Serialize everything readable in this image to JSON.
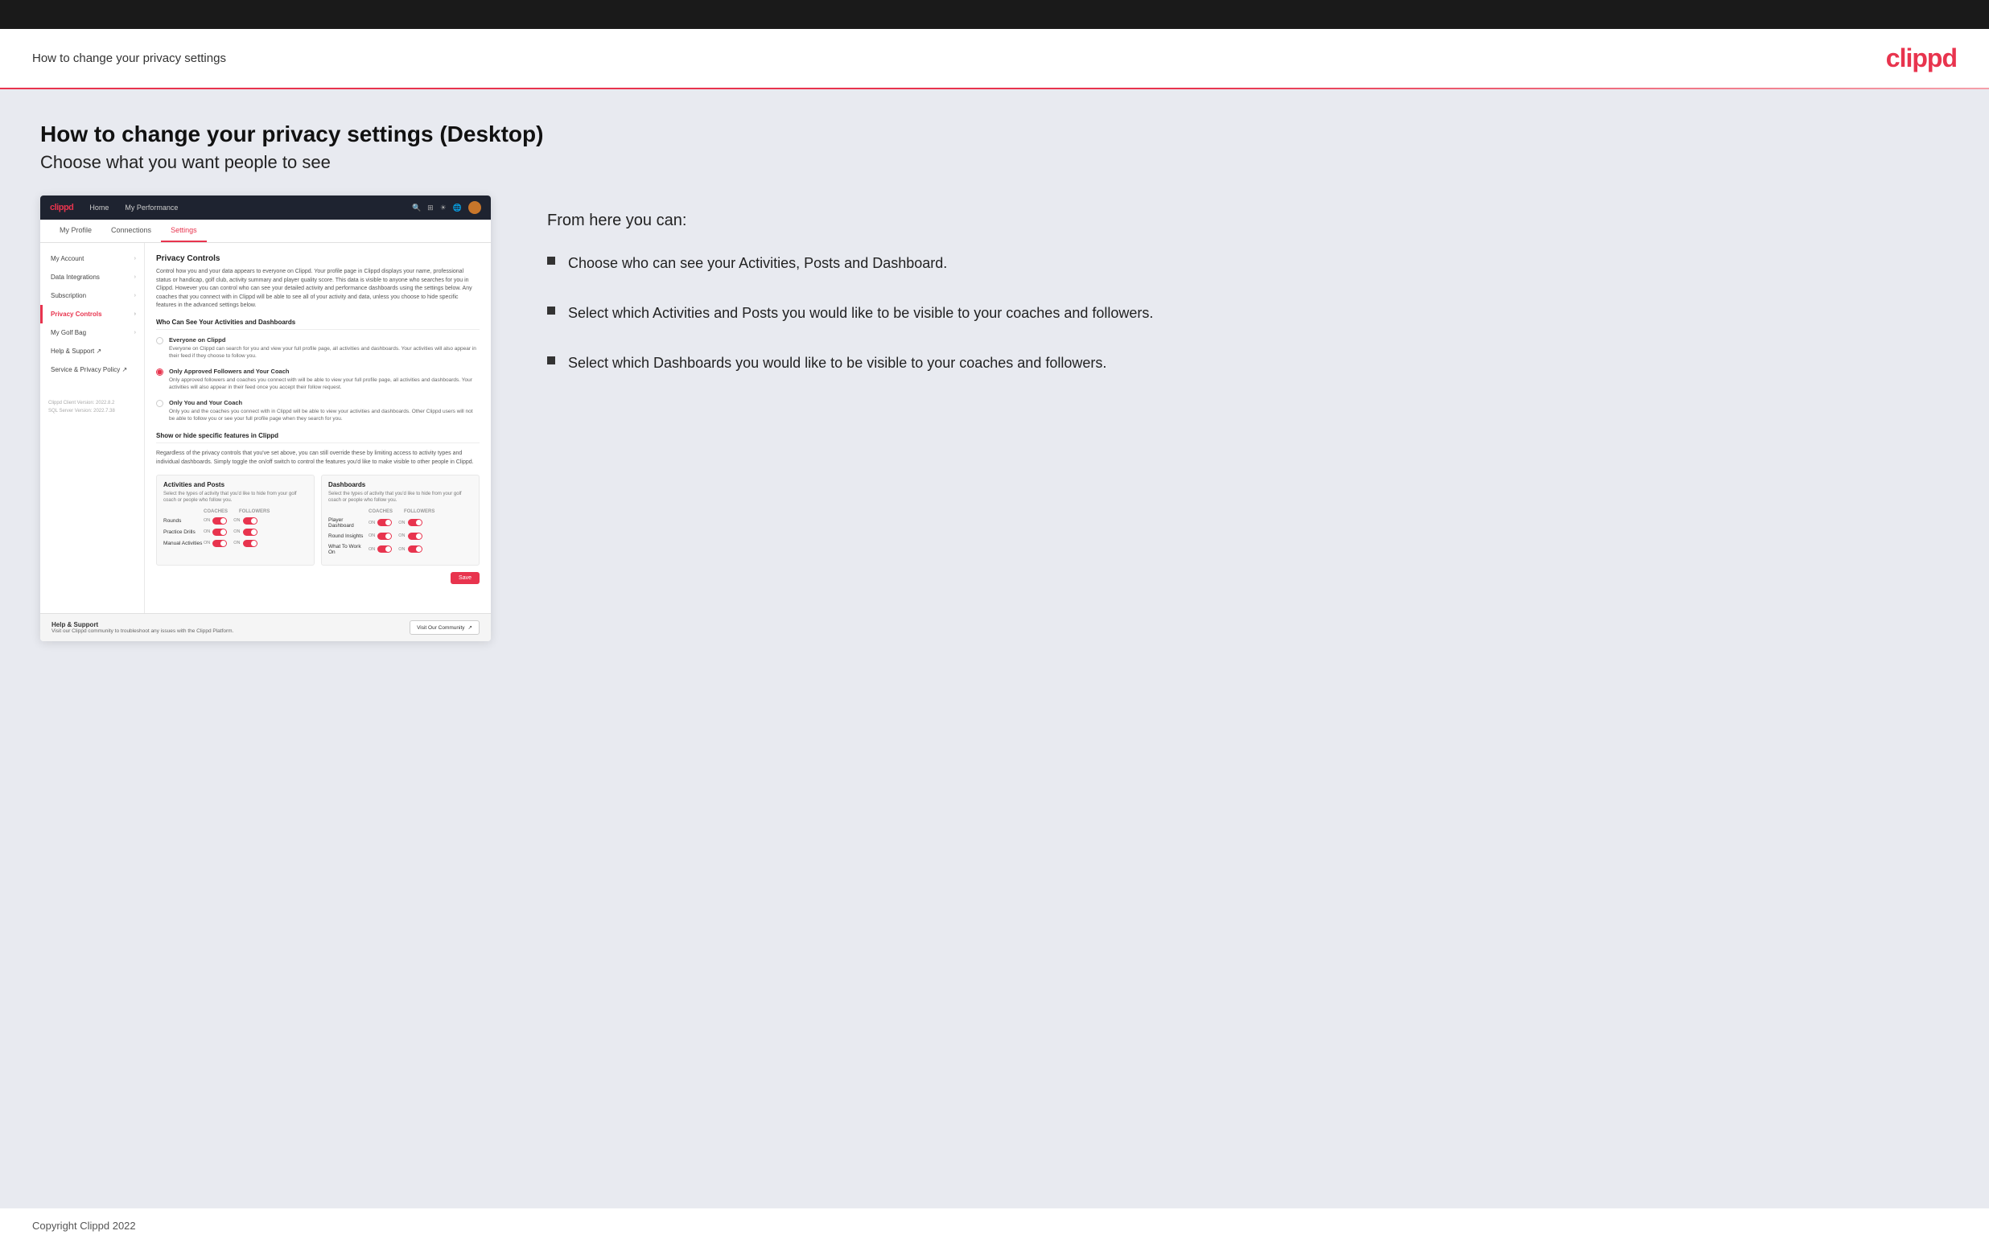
{
  "topBar": {},
  "header": {
    "title": "How to change your privacy settings",
    "logo": "clippd"
  },
  "page": {
    "heading": "How to change your privacy settings (Desktop)",
    "subheading": "Choose what you want people to see"
  },
  "rightPanel": {
    "title": "From here you can:",
    "bullets": [
      "Choose who can see your Activities, Posts and Dashboard.",
      "Select which Activities and Posts you would like to be visible to your coaches and followers.",
      "Select which Dashboards you would like to be visible to your coaches and followers."
    ]
  },
  "mockup": {
    "nav": {
      "logo": "clippd",
      "items": [
        "Home",
        "My Performance"
      ],
      "icons": [
        "🔍",
        "⊞",
        "☀",
        "🌐"
      ]
    },
    "subnav": {
      "items": [
        "My Profile",
        "Connections",
        "Settings"
      ]
    },
    "sidebar": {
      "items": [
        {
          "label": "My Account",
          "active": false
        },
        {
          "label": "Data Integrations",
          "active": false
        },
        {
          "label": "Subscription",
          "active": false
        },
        {
          "label": "Privacy Controls",
          "active": true
        },
        {
          "label": "My Golf Bag",
          "active": false
        },
        {
          "label": "Help & Support",
          "active": false
        },
        {
          "label": "Service & Privacy Policy",
          "active": false
        }
      ],
      "version": "Clippd Client Version: 2022.8.2\nSQL Server Version: 2022.7.38"
    },
    "main": {
      "sectionTitle": "Privacy Controls",
      "sectionDesc": "Control how you and your data appears to everyone on Clippd. Your profile page in Clippd displays your name, professional status or handicap, golf club, activity summary and player quality score. This data is visible to anyone who searches for you in Clippd. However you can control who can see your detailed activity and performance dashboards using the settings below. Any coaches that you connect with in Clippd will be able to see all of your activity and data, unless you choose to hide specific features in the advanced settings below.",
      "whoCanSee": {
        "title": "Who Can See Your Activities and Dashboards",
        "options": [
          {
            "label": "Everyone on Clippd",
            "desc": "Everyone on Clippd can search for you and view your full profile page, all activities and dashboards. Your activities will also appear in their feed if they choose to follow you.",
            "selected": false
          },
          {
            "label": "Only Approved Followers and Your Coach",
            "desc": "Only approved followers and coaches you connect with will be able to view your full profile page, all activities and dashboards. Your activities will also appear in their feed once you accept their follow request.",
            "selected": true
          },
          {
            "label": "Only You and Your Coach",
            "desc": "Only you and the coaches you connect with in Clippd will be able to view your activities and dashboards. Other Clippd users will not be able to follow you or see your full profile page when they search for you.",
            "selected": false
          }
        ]
      },
      "showHide": {
        "title": "Show or hide specific features in Clippd",
        "desc": "Regardless of the privacy controls that you've set above, you can still override these by limiting access to activity types and individual dashboards. Simply toggle the on/off switch to control the features you'd like to make visible to other people in Clippd.",
        "activities": {
          "title": "Activities and Posts",
          "desc": "Select the types of activity that you'd like to hide from your golf coach or people who follow you.",
          "headers": [
            "COACHES",
            "FOLLOWERS"
          ],
          "rows": [
            {
              "label": "Rounds",
              "coachOn": true,
              "followerOn": true
            },
            {
              "label": "Practice Drills",
              "coachOn": true,
              "followerOn": true
            },
            {
              "label": "Manual Activities",
              "coachOn": true,
              "followerOn": true
            }
          ]
        },
        "dashboards": {
          "title": "Dashboards",
          "desc": "Select the types of activity that you'd like to hide from your golf coach or people who follow you.",
          "headers": [
            "COACHES",
            "FOLLOWERS"
          ],
          "rows": [
            {
              "label": "Player Dashboard",
              "coachOn": true,
              "followerOn": true
            },
            {
              "label": "Round Insights",
              "coachOn": true,
              "followerOn": true
            },
            {
              "label": "What To Work On",
              "coachOn": true,
              "followerOn": true
            }
          ]
        }
      },
      "saveBtn": "Save"
    },
    "helpBar": {
      "title": "Help & Support",
      "desc": "Visit our Clippd community to troubleshoot any issues with the Clippd Platform.",
      "btnLabel": "Visit Our Community"
    }
  },
  "footer": {
    "copyright": "Copyright Clippd 2022"
  }
}
